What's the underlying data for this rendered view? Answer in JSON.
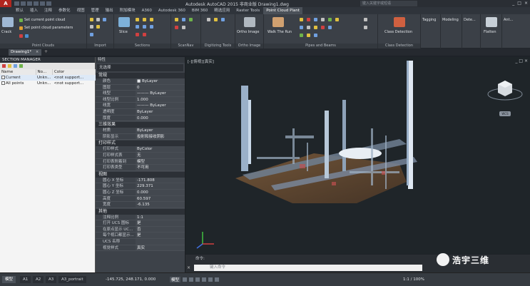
{
  "title_bar": {
    "app_logo": "A",
    "title": "Autodesk AutoCAD 2015   非商业版   Drawing1.dwg",
    "search_placeholder": "键入关键字或短语"
  },
  "ribbon_tabs": [
    "默认",
    "插入",
    "注释",
    "参数化",
    "视图",
    "管理",
    "输出",
    "附加模块",
    "A360",
    "Autodesk 360",
    "BIM 360",
    "精选应用",
    "Raster Tools",
    "Point Cloud Plant"
  ],
  "ribbon_active_tab": "Point Cloud Plant",
  "ribbon_groups": {
    "point_clouds": {
      "label": "Point Clouds",
      "btn_large": "Crack",
      "btn1": "Set current point cloud",
      "btn2": "Set point cloud parameters"
    },
    "import": {
      "label": "Import"
    },
    "sections": {
      "label": "Sections",
      "btn_slice": "Slice"
    },
    "scan_nav": {
      "label": "ScanNav"
    },
    "digitizing": {
      "label": "Digitizing Tools"
    },
    "ortho": {
      "label": "Ortho Image",
      "btn": "Ortho Image"
    },
    "pipes": {
      "label": "Pipes and Beams",
      "btn": "Walk The Run"
    },
    "class_detect": {
      "label": "Class Detection",
      "btn": "Class Detection"
    },
    "rightmost": [
      "Tagging",
      "Modeling",
      "Dete...",
      "Flatten",
      "Ant..."
    ]
  },
  "doc_tab": {
    "name": "Drawing1*"
  },
  "section_manager": {
    "title": "SECTION MANAGER",
    "columns": [
      "Name",
      "No...",
      "Color"
    ],
    "rows": [
      {
        "name": "Current",
        "num": "Unkn...",
        "color": "<not support..."
      },
      {
        "name": "All points",
        "num": "Unkn...",
        "color": "<not support..."
      }
    ]
  },
  "properties": {
    "title": "特性",
    "selection": "无选择",
    "sections": [
      {
        "name": "常规",
        "rows": [
          {
            "k": "颜色",
            "v": "■ ByLayer"
          },
          {
            "k": "图层",
            "v": "0"
          },
          {
            "k": "线型",
            "v": "——— ByLayer"
          },
          {
            "k": "线型比例",
            "v": "1.000"
          },
          {
            "k": "线宽",
            "v": "——— ByLayer"
          },
          {
            "k": "透明度",
            "v": "ByLayer"
          },
          {
            "k": "厚度",
            "v": "0.000"
          }
        ]
      },
      {
        "name": "三维效果",
        "rows": [
          {
            "k": "材质",
            "v": "ByLayer"
          },
          {
            "k": "阴影显示",
            "v": "投射和接收阴影"
          }
        ]
      },
      {
        "name": "打印样式",
        "rows": [
          {
            "k": "打印样式",
            "v": "ByColor"
          },
          {
            "k": "打印样式表",
            "v": "无"
          },
          {
            "k": "打印表附着到",
            "v": "模型"
          },
          {
            "k": "打印表类型",
            "v": "不可用"
          }
        ]
      },
      {
        "name": "视图",
        "rows": [
          {
            "k": "圆心 X 坐标",
            "v": "-171.808"
          },
          {
            "k": "圆心 Y 坐标",
            "v": "229.371"
          },
          {
            "k": "圆心 Z 坐标",
            "v": "0.000"
          },
          {
            "k": "高度",
            "v": "60.597"
          },
          {
            "k": "宽度",
            "v": "-6.135"
          }
        ]
      },
      {
        "name": "其他",
        "rows": [
          {
            "k": "注释比例",
            "v": "1:1"
          },
          {
            "k": "打开 UCS 图标",
            "v": "是"
          },
          {
            "k": "在原点显示 UC...",
            "v": "否"
          },
          {
            "k": "每个视口都显示...",
            "v": "是"
          },
          {
            "k": "UCS 名称",
            "v": ""
          },
          {
            "k": "视觉样式",
            "v": "真实"
          }
        ]
      }
    ]
  },
  "viewport": {
    "label": "[-][俯视][真实]",
    "controls": "_ □ ×",
    "viewcube_label": "WCS"
  },
  "command_line": {
    "history": "命令:",
    "placeholder": "键入命令"
  },
  "watermark": {
    "text": "浩宇三维"
  },
  "status_bar": {
    "layout_tabs": [
      "模型",
      "A1",
      "A2",
      "A3",
      "A3_portrait"
    ],
    "active_layout": "模型",
    "coords": "-145.725, 248.171, 0.000",
    "mode": "模型",
    "zoom": "1:1 / 100%"
  },
  "colors": {
    "accent_red": "#b2261f",
    "ribbon_bg": "#3b4047",
    "viewport_bg": "#1f2529"
  }
}
